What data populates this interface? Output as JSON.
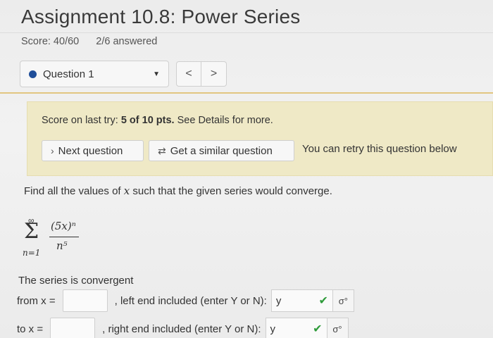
{
  "assignment": {
    "title": "Assignment 10.8: Power Series",
    "score": "Score: 40/60",
    "answered": "2/6 answered"
  },
  "question_nav": {
    "selected": "Question 1",
    "prev_label": "<",
    "next_label": ">"
  },
  "retry": {
    "prefix": "Score on last try:",
    "score": "5 of 10 pts.",
    "suffix": "See Details for more.",
    "next_button": "Next question",
    "similar_button": "Get a similar question",
    "note": "You can retry this question below"
  },
  "question": {
    "prompt_before": "Find all the values of",
    "prompt_var": "x",
    "prompt_after": "such that the given series would converge.",
    "series": {
      "upper": "∞",
      "lower": "n=1",
      "numerator": "(5x)ⁿ",
      "denominator": "n⁵"
    },
    "convergent_text": "The series is convergent",
    "from_label": "from x =",
    "from_value": "",
    "left_end_label": ", left end included (enter Y or N):",
    "left_end_value": "y",
    "to_label": "to x =",
    "to_value": "",
    "right_end_label": ", right end included (enter Y or N):",
    "right_end_value": "y"
  },
  "colors": {
    "dot": "#1f4e99",
    "retry_bg": "#efe9c6",
    "divider": "#e2c680",
    "check": "#2e9b3a"
  },
  "icons": {
    "caret": "caret-down-icon",
    "similar": "refresh-icon",
    "check": "check-icon",
    "equation": "equation-editor-icon"
  }
}
